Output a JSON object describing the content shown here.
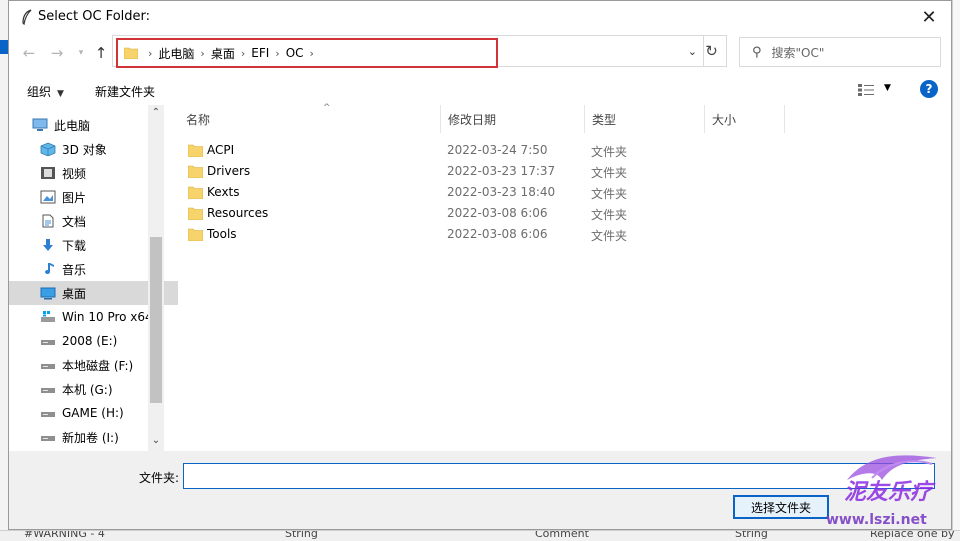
{
  "window": {
    "title": "Select OC Folder:"
  },
  "navigation": {
    "breadcrumbs": [
      "此电脑",
      "桌面",
      "EFI",
      "OC"
    ],
    "search_placeholder": "搜索\"OC\""
  },
  "toolbar": {
    "organize_label": "组织",
    "new_folder_label": "新建文件夹"
  },
  "nav_pane": {
    "items": [
      {
        "label": "此电脑",
        "icon": "computer-icon"
      },
      {
        "label": "3D 对象",
        "icon": "cube-icon"
      },
      {
        "label": "视频",
        "icon": "video-icon"
      },
      {
        "label": "图片",
        "icon": "picture-icon"
      },
      {
        "label": "文档",
        "icon": "document-icon"
      },
      {
        "label": "下载",
        "icon": "download-icon"
      },
      {
        "label": "音乐",
        "icon": "music-icon"
      },
      {
        "label": "桌面",
        "icon": "desktop-icon",
        "selected": true
      },
      {
        "label": "Win 10 Pro x64",
        "icon": "system-drive-icon"
      },
      {
        "label": "2008 (E:)",
        "icon": "drive-icon"
      },
      {
        "label": "本地磁盘 (F:)",
        "icon": "drive-icon"
      },
      {
        "label": "本机 (G:)",
        "icon": "drive-icon"
      },
      {
        "label": "GAME (H:)",
        "icon": "drive-icon"
      },
      {
        "label": "新加卷 (I:)",
        "icon": "drive-icon"
      }
    ]
  },
  "file_list": {
    "columns": [
      "名称",
      "修改日期",
      "类型",
      "大小"
    ],
    "rows": [
      {
        "name": "ACPI",
        "date": "2022-03-24 7:50",
        "type": "文件夹"
      },
      {
        "name": "Drivers",
        "date": "2022-03-23 17:37",
        "type": "文件夹"
      },
      {
        "name": "Kexts",
        "date": "2022-03-23 18:40",
        "type": "文件夹"
      },
      {
        "name": "Resources",
        "date": "2022-03-08 6:06",
        "type": "文件夹"
      },
      {
        "name": "Tools",
        "date": "2022-03-08 6:06",
        "type": "文件夹"
      }
    ]
  },
  "bottom": {
    "folder_label": "文件夹:",
    "folder_value": "",
    "select_button_label": "选择文件夹"
  },
  "watermark": {
    "brand": "泥友乐疗",
    "url": "www.lszi.net"
  },
  "background": {
    "bottom_texts": [
      "#WARNING - 4",
      "String",
      "Comment",
      "String",
      "Replace one by"
    ]
  },
  "colors": {
    "accent": "#0a64c8",
    "highlight_border": "#d13438",
    "folder": "#f6d36b"
  }
}
